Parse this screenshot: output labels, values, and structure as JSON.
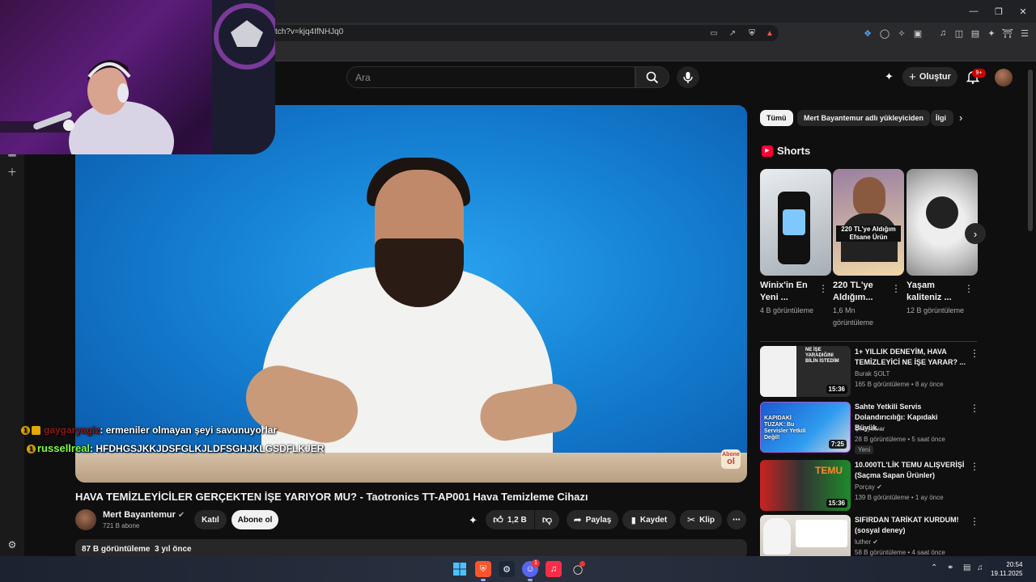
{
  "browser": {
    "url": "tch?v=kjq4IfNHJq0"
  },
  "youtube": {
    "search_placeholder": "Ara",
    "create_label": "Oluştur",
    "notif_count": "9+"
  },
  "video": {
    "title": "HAVA TEMİZLEYİCİLER GERÇEKTEN İŞE YARIYOR MU? - Taotronics TT-AP001 Hava Temizleme Cihazı",
    "channel": "Mert Bayantemur",
    "subscribers": "721 B abone",
    "join_label": "Katıl",
    "subscribe_label": "Abone ol",
    "likes": "1,2 B",
    "share_label": "Paylaş",
    "save_label": "Kaydet",
    "clip_label": "Klip",
    "views": "87 B görüntüleme",
    "published": "3 yıl önce",
    "watermark_top": "Abone",
    "watermark_bottom": "ol"
  },
  "chat": [
    {
      "user": "gaygaryagiz",
      "user_color": "#8b1a1a",
      "message": ": ermeniler olmayan şeyi savunuyorlar"
    },
    {
      "user": "russellreal",
      "user_color": "#7dff3a",
      "message": ": HFDHGSJKKJDSFGLKJLDFSGHJKLGSDFLKJER"
    }
  ],
  "chips": [
    "Tümü",
    "Mert Bayantemur adlı yükleyiciden",
    "İlgi"
  ],
  "shorts_title": "Shorts",
  "shorts": [
    {
      "title": "Winix'in En Yeni ...",
      "views": "4 B görüntüleme"
    },
    {
      "title": "220 TL'ye Aldığım...",
      "views": "1,6 Mn görüntüleme",
      "thumb_text": "220 TL'ye Aldığım Efsane Ürün"
    },
    {
      "title": "Yaşam kaliteniz ...",
      "views": "12 B görüntüleme"
    }
  ],
  "related": [
    {
      "title": "1+ YILLIK DENEYİM, HAVA TEMİZLEYİCİ NE İŞE YARAR? ...",
      "channel": "Burak ŞOLT",
      "verified": false,
      "meta": "165 B görüntüleme • 8 ay önce",
      "duration": "15:36",
      "thumb_text": "NE İŞE YARADIĞINI BİLİN İSTEDİM"
    },
    {
      "title": "Sahte Yetkili Servis Dolandırıcılığı: Kapıdaki Büyük...",
      "channel": "Şikayetvar",
      "verified": false,
      "meta": "28 B görüntüleme • 5 saat önce",
      "duration": "7:25",
      "badge": "Yeni",
      "thumb_text": "KAPIDAKİ TUZAK: Bu Servisler Yetkili Değil!"
    },
    {
      "title": "10.000TL'LİK TEMU ALIŞVERİŞİ (Saçma Sapan Ürünler)",
      "channel": "Porçay",
      "verified": true,
      "meta": "139 B görüntüleme • 1 ay önce",
      "duration": "15:36",
      "thumb_text": "TEMU"
    },
    {
      "title": "SIFIRDAN TARİKAT KURDUM! (sosyal deney)",
      "channel": "luther",
      "verified": true,
      "meta": "58 B görüntüleme • 4 saat önce",
      "duration": ""
    }
  ],
  "taskbar": {
    "time": "20:54",
    "date": "19.11.2025",
    "discord_badge": "1"
  },
  "colors": {
    "yt_red": "#ff0000",
    "background": "#0f0f0f",
    "chip_bg": "#272727"
  }
}
